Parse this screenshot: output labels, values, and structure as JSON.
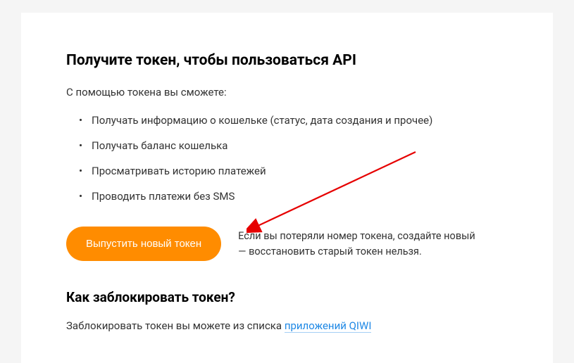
{
  "main": {
    "title": "Получите токен, чтобы пользоваться API",
    "intro": "С помощью токена вы сможете:",
    "bullets": [
      "Получать информацию о кошельке (статус, дата создания и прочее)",
      "Получать баланс кошелька",
      "Просматривать историю платежей",
      "Проводить платежи без SMS"
    ],
    "button_label": "Выпустить новый токен",
    "hint": "Если вы потеряли номер токена, создайте новый — восстановить старый токен нельзя."
  },
  "block_section": {
    "heading": "Как заблокировать токен?",
    "text_prefix": "Заблокировать токен вы можете из списка ",
    "link_text": "приложений QIWI"
  }
}
